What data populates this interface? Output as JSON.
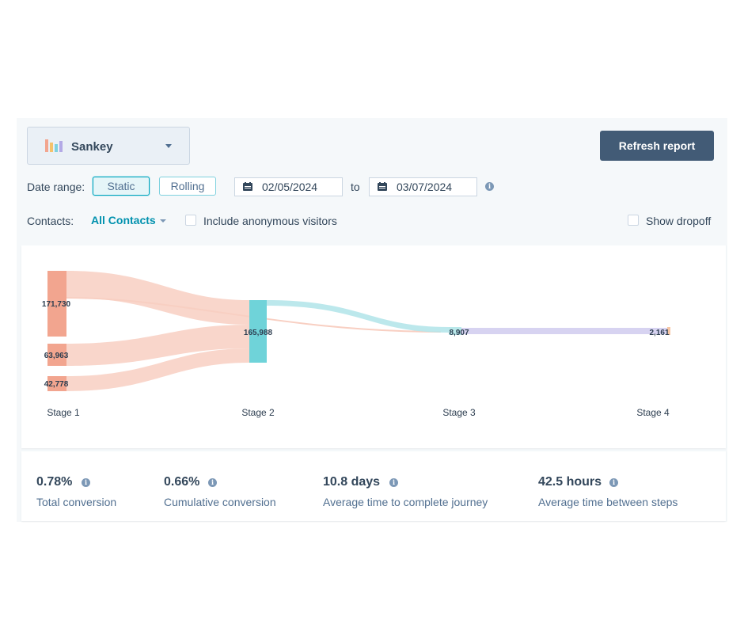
{
  "toolbar": {
    "chart_type_label": "Sankey",
    "chart_type_icon": "bar-chart-icon",
    "refresh_label": "Refresh report"
  },
  "date_range": {
    "label": "Date range:",
    "options": [
      "Static",
      "Rolling"
    ],
    "selected": "Static",
    "start": "02/05/2024",
    "to_label": "to",
    "end": "03/07/2024"
  },
  "contacts": {
    "label": "Contacts:",
    "value": "All Contacts",
    "include_anonymous_label": "Include anonymous visitors",
    "include_anonymous_checked": false,
    "show_dropoff_label": "Show dropoff",
    "show_dropoff_checked": false
  },
  "chart_data": {
    "type": "sankey",
    "stages": [
      "Stage 1",
      "Stage 2",
      "Stage 3",
      "Stage 4"
    ],
    "nodes": [
      {
        "stage": "Stage 1",
        "value_label": "171,730",
        "color": "#f2a58f"
      },
      {
        "stage": "Stage 1",
        "value_label": "63,963",
        "color": "#f2a58f"
      },
      {
        "stage": "Stage 1",
        "value_label": "42,778",
        "color": "#f2a58f"
      },
      {
        "stage": "Stage 2",
        "value_label": "165,988",
        "color": "#6fd3d9"
      },
      {
        "stage": "Stage 3",
        "value_label": "8,907",
        "color": "#b9e8ea"
      },
      {
        "stage": "Stage 4",
        "value_label": "2,161",
        "color": "#f7c6a3"
      }
    ],
    "colors": {
      "stage1_flow": "#f8cfc2",
      "stage2_node": "#6fd3d9",
      "stage2_flow": "#b5e6ea",
      "stage3_flow": "#d7d3f1"
    }
  },
  "stats": [
    {
      "value": "0.78%",
      "label": "Total conversion"
    },
    {
      "value": "0.66%",
      "label": "Cumulative conversion"
    },
    {
      "value": "10.8 days",
      "label": "Average time to complete journey"
    },
    {
      "value": "42.5 hours",
      "label": "Average time between steps"
    }
  ]
}
